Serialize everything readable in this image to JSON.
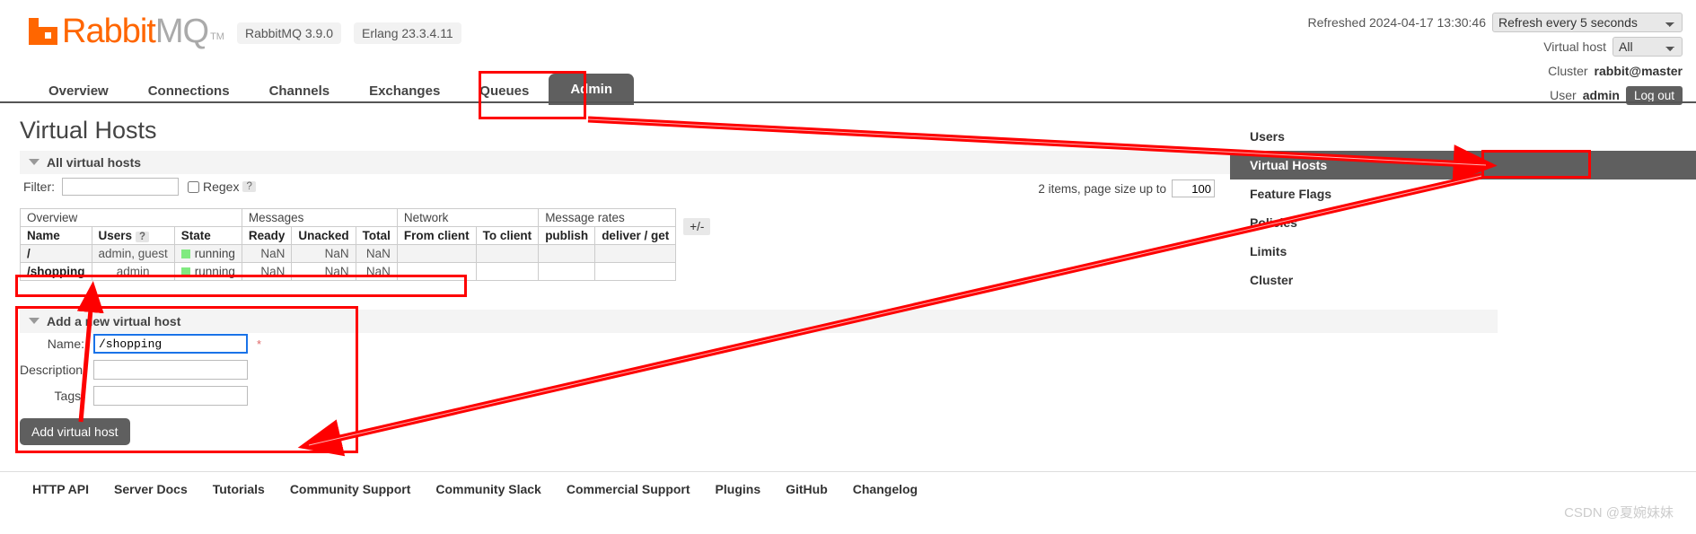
{
  "brand": {
    "name_part1": "Rabbit",
    "name_part2": "MQ",
    "tm": "TM",
    "version_badge": "RabbitMQ 3.9.0",
    "erlang_badge": "Erlang 23.3.4.11"
  },
  "header": {
    "refreshed_text": "Refreshed 2024-04-17 13:30:46",
    "refresh_interval": "Refresh every 5 seconds",
    "virtual_host_label": "Virtual host",
    "virtual_host_value": "All",
    "cluster_label": "Cluster",
    "cluster_value": "rabbit@master",
    "user_label": "User",
    "user_value": "admin",
    "logout_label": "Log out"
  },
  "tabs": [
    {
      "label": "Overview",
      "active": false
    },
    {
      "label": "Connections",
      "active": false
    },
    {
      "label": "Channels",
      "active": false
    },
    {
      "label": "Exchanges",
      "active": false
    },
    {
      "label": "Queues",
      "active": false
    },
    {
      "label": "Admin",
      "active": true
    }
  ],
  "main": {
    "page_title": "Virtual Hosts",
    "all_hosts_section": "All virtual hosts",
    "filter_label": "Filter:",
    "filter_value": "",
    "regex_label": "Regex",
    "regex_help": "?",
    "items_info_prefix": "2 items, page size up to",
    "page_size": "100",
    "plus_minus": "+/-"
  },
  "table": {
    "group_headers": [
      {
        "label": "Overview",
        "span": 3
      },
      {
        "label": "Messages",
        "span": 3
      },
      {
        "label": "Network",
        "span": 2
      },
      {
        "label": "Message rates",
        "span": 2
      }
    ],
    "columns": [
      "Name",
      "Users",
      "State",
      "Ready",
      "Unacked",
      "Total",
      "From client",
      "To client",
      "publish",
      "deliver / get"
    ],
    "users_help": "?",
    "rows": [
      {
        "name": "/",
        "users": "admin, guest",
        "state": "running",
        "ready": "NaN",
        "unacked": "NaN",
        "total": "NaN",
        "from_client": "",
        "to_client": "",
        "publish": "",
        "deliver_get": ""
      },
      {
        "name": "/shopping",
        "users": "admin",
        "state": "running",
        "ready": "NaN",
        "unacked": "NaN",
        "total": "NaN",
        "from_client": "",
        "to_client": "",
        "publish": "",
        "deliver_get": ""
      }
    ]
  },
  "add_form": {
    "section_title": "Add a new virtual host",
    "name_label": "Name:",
    "name_value": "/shopping",
    "required_marker": "*",
    "description_label": "Description:",
    "description_value": "",
    "tags_label": "Tags:",
    "tags_value": "",
    "submit_label": "Add virtual host"
  },
  "right_menu": [
    {
      "label": "Users",
      "active": false
    },
    {
      "label": "Virtual Hosts",
      "active": true
    },
    {
      "label": "Feature Flags",
      "active": false
    },
    {
      "label": "Policies",
      "active": false
    },
    {
      "label": "Limits",
      "active": false
    },
    {
      "label": "Cluster",
      "active": false
    }
  ],
  "footer_links": [
    "HTTP API",
    "Server Docs",
    "Tutorials",
    "Community Support",
    "Community Slack",
    "Commercial Support",
    "Plugins",
    "GitHub",
    "Changelog"
  ],
  "watermark": "CSDN @夏婉妹妹",
  "colors": {
    "brand_orange": "#ff6600",
    "annotation_red": "#fe0000",
    "active_gray": "#5f5f5f",
    "status_green": "#80ea80"
  }
}
